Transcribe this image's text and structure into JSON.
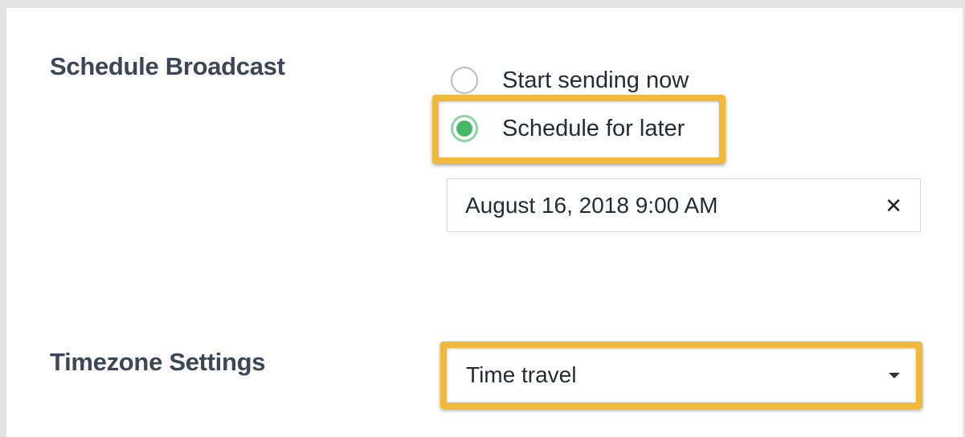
{
  "schedule": {
    "label": "Schedule Broadcast",
    "options": [
      {
        "label": "Start sending now",
        "selected": false
      },
      {
        "label": "Schedule for later",
        "selected": true
      }
    ],
    "datetime_value": "August 16, 2018 9:00 AM",
    "clear_icon": "close-icon"
  },
  "timezone": {
    "label": "Timezone Settings",
    "selected": "Time travel",
    "dropdown_icon": "chevron-down-icon"
  },
  "colors": {
    "highlight": "#f0b93c",
    "radio_selected": "#47b964",
    "label_text": "#3b4656"
  }
}
